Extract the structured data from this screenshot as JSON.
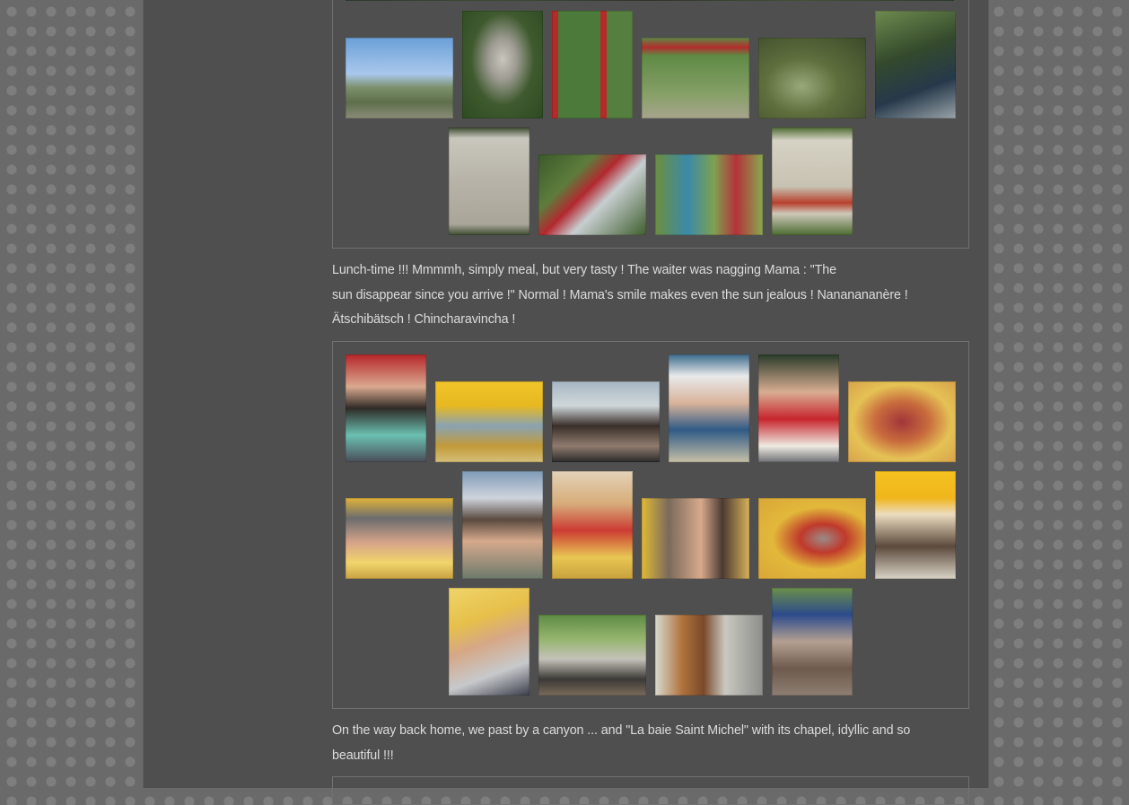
{
  "paragraphs": {
    "lunch": {
      "line1": "Lunch-time !!! Mmmmh, simply meal, but very tasty ! The waiter was nagging Mama : \"The",
      "line2": "sun disappear since you arrive !\" Normal ! Mama's smile makes even the sun jealous ! Nananananère !",
      "line3": "Ätschibätsch ! Chincharavincha !"
    },
    "canyon": {
      "line1": "On the way back home, we past by a canyon ... and \"La baie Saint Michel\" with its chapel, idyllic and so",
      "line2": "beautiful !!!"
    }
  },
  "colors": {
    "page_background": "#4f4f4f",
    "pattern_background": "#6a6a6a",
    "text": "#dcdcdc",
    "gallery_border": "#717171"
  }
}
